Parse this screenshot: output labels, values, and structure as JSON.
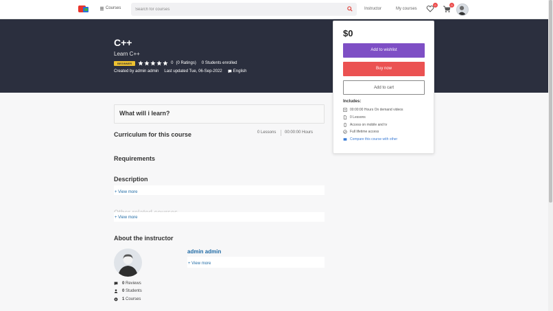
{
  "nav": {
    "courses_label": "Courses",
    "search_placeholder": "Search for courses",
    "instructor_label": "Instructor",
    "my_courses_label": "My courses",
    "wishlist_count": "0",
    "cart_count": "0"
  },
  "hero": {
    "title": "C++",
    "subtitle": "Learn C++",
    "level": "BEGINNER",
    "rating_value": "0",
    "ratings_text": "(0 Ratings)",
    "students_text": "0 Students enrolled",
    "created_by": "Created by admin admin",
    "last_updated": "Last updated Tue, 06-Sep-2022",
    "language": "English"
  },
  "card": {
    "price": "$0",
    "wishlist_label": "Add to wishlist",
    "buy_label": "Buy now",
    "cart_label": "Add to cart",
    "includes_title": "Includes:",
    "includes": [
      {
        "icon": "video-icon",
        "text": "00:00:00 Hours On demand videos"
      },
      {
        "icon": "file-icon",
        "text": "0 Lessons"
      },
      {
        "icon": "mobile-icon",
        "text": "Access on mobile and tv"
      },
      {
        "icon": "check-circle-icon",
        "text": "Full lifetime access"
      },
      {
        "icon": "compare-icon",
        "text": "Compare this course with other"
      }
    ]
  },
  "main": {
    "learn_title": "What will i learn?",
    "curriculum_title": "Curriculum for this course",
    "lessons": "0 Lessons",
    "hours": "00:00:00 Hours",
    "requirements_title": "Requirements",
    "description_title": "Description",
    "view_more": "+ View more",
    "other_courses_title": "Other related courses",
    "about_instructor_title": "About the instructor",
    "instructor_name": "admin admin",
    "reviews": {
      "count": "0",
      "label": "Reviews"
    },
    "students": {
      "count": "0",
      "label": "Students"
    },
    "courses": {
      "count": "1",
      "label": "Courses"
    }
  },
  "colors": {
    "hero_bg": "#2b2f3e",
    "wishlist_btn": "#7e4fc5",
    "buy_btn": "#eb5252",
    "level_badge": "#eec231",
    "link": "#1f6aa5"
  }
}
